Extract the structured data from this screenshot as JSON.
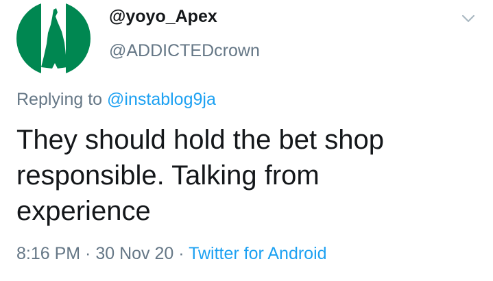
{
  "author": {
    "display_name": "@yoyo_Apex",
    "handle": "@ADDICTEDcrown",
    "avatar_colors": {
      "left_band": "#008751",
      "center_band": "#ffffff",
      "right_band": "#008751",
      "figure": "#008751"
    }
  },
  "menu": {
    "icon": "chevron-down-icon"
  },
  "reply": {
    "prefix": "Replying to",
    "mention": "@instablog9ja"
  },
  "tweet": {
    "text_lines": [
      "They should hold the bet shop",
      "responsible. Talking from",
      "experience"
    ]
  },
  "meta": {
    "time": "8:16 PM",
    "separator_1": " · ",
    "date": "30 Nov 20",
    "separator_2": " · ",
    "source": "Twitter for Android"
  },
  "colors": {
    "text_primary": "#14171a",
    "text_secondary": "#657786",
    "link": "#1da1f2"
  }
}
